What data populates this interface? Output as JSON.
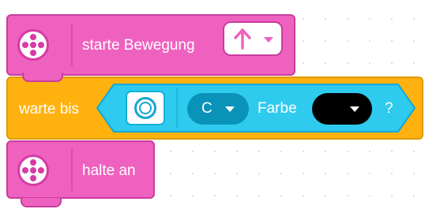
{
  "blocks": {
    "start_move": {
      "label": "starte Bewegung",
      "icon": "motor-icon",
      "direction": {
        "value_icon": "arrow-up-icon",
        "caret": "chevron-down-icon"
      }
    },
    "wait_until": {
      "label": "warte bis",
      "condition": {
        "sensor_icon": "color-sensor-icon",
        "port": "C",
        "color_label": "Farbe",
        "color_value": "#000000",
        "suffix": "?"
      }
    },
    "stop": {
      "label": "halte an",
      "icon": "motor-icon"
    }
  },
  "colors": {
    "motor_pink": "#ef61bf",
    "control_yellow": "#ffb20f",
    "sensor_cyan": "#2ecbef",
    "port_blue": "#0a93b8"
  }
}
